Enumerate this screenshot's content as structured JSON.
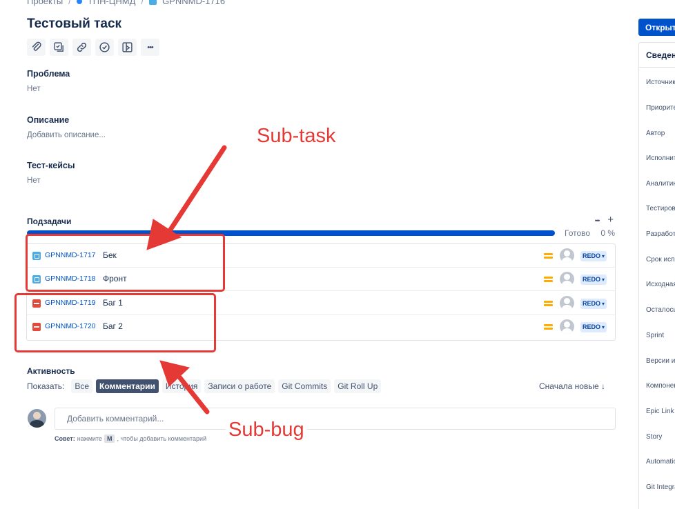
{
  "breadcrumb": {
    "items": [
      "Проекты",
      "ТПН-ЦНМД",
      "GPNNMD-1716"
    ]
  },
  "issue": {
    "title": "Тестовый таск"
  },
  "toolbar": {
    "buttons": [
      {
        "icon": "paperclip-icon"
      },
      {
        "icon": "checklist-icon"
      },
      {
        "icon": "link-icon"
      },
      {
        "icon": "check-circle-icon"
      },
      {
        "icon": "branch-icon"
      },
      {
        "icon": "more-icon",
        "text": "•••"
      }
    ]
  },
  "fields": {
    "problem": {
      "label": "Проблема",
      "value": "Нет"
    },
    "description": {
      "label": "Описание",
      "value": "Добавить описание..."
    },
    "test_cases": {
      "label": "Тест-кейсы",
      "value": "Нет"
    }
  },
  "subtasks": {
    "title": "Подзадачи",
    "more": "•••",
    "add": "+",
    "progress_label": "Готово",
    "progress_percent": "0 %",
    "progress_fill": 1.0,
    "rows": [
      {
        "type": "subtask",
        "key": "GPNNMD-1717",
        "summary": "Бек",
        "status": "REDO"
      },
      {
        "type": "subtask",
        "key": "GPNNMD-1718",
        "summary": "Фронт",
        "status": "REDO"
      },
      {
        "type": "bug",
        "key": "GPNNMD-1719",
        "summary": "Баг 1",
        "status": "REDO"
      },
      {
        "type": "bug",
        "key": "GPNNMD-1720",
        "summary": "Баг 2",
        "status": "REDO"
      }
    ]
  },
  "activity": {
    "title": "Активность",
    "show_label": "Показать:",
    "filters": [
      "Все",
      "Комментарии",
      "История",
      "Записи о работе",
      "Git Commits",
      "Git Roll Up"
    ],
    "active_filter": "Комментарии",
    "sort": "Сначала новые ↓"
  },
  "comment": {
    "placeholder": "Добавить комментарий...",
    "tip_prefix": "Совет:",
    "tip_mid": "нажмите",
    "tip_key": "M",
    "tip_suffix": ", чтобы добавить комментарий"
  },
  "sidebar": {
    "open_button": "Открыто",
    "header": "Сведения",
    "items": [
      "Источник",
      "Приоритет",
      "Автор",
      "Исполнитель",
      "Аналитик",
      "Тестировщик",
      "Разработчик",
      "Срок исполнения",
      "Исходная оценка",
      "Осталось",
      "Sprint",
      "Версии исправления",
      "Компоненты",
      "Epic Link",
      "Story",
      "Automation",
      "Git Integration"
    ]
  },
  "annotations": {
    "subtask_label": "Sub-task",
    "subbug_label": "Sub-bug",
    "color": "#e53935"
  }
}
